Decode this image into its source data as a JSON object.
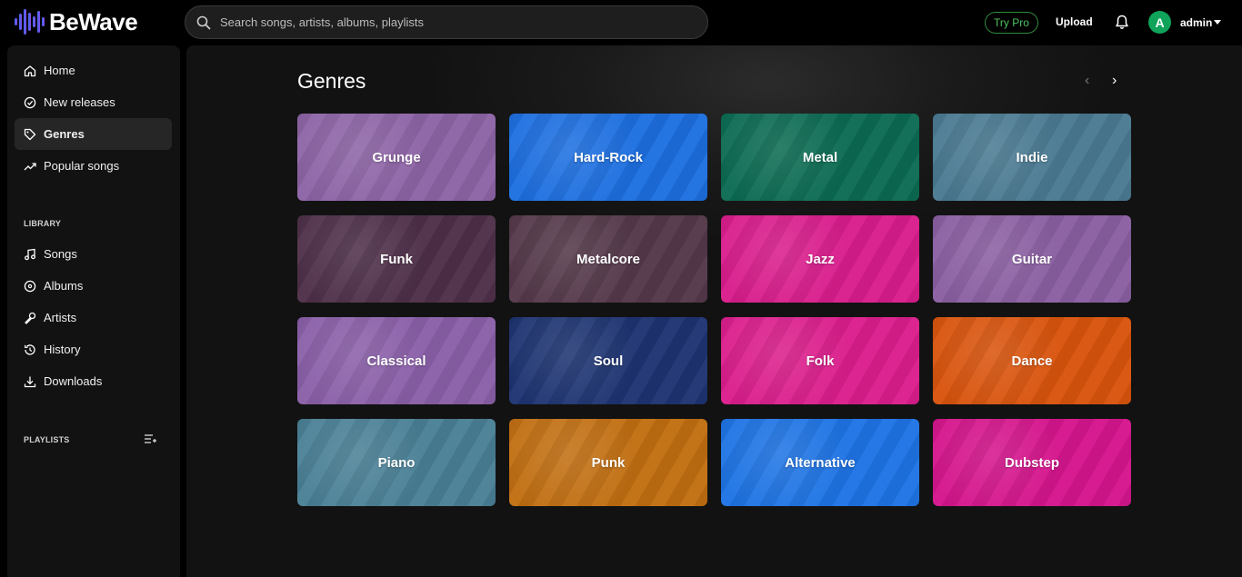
{
  "app": {
    "name": "BeWave"
  },
  "search": {
    "placeholder": "Search songs, artists, albums, playlists"
  },
  "header": {
    "try_pro": "Try Pro",
    "upload": "Upload",
    "avatar_initial": "A",
    "username": "admin"
  },
  "sidebar": {
    "main": [
      {
        "label": "Home",
        "icon": "home-icon"
      },
      {
        "label": "New releases",
        "icon": "check-circle-icon"
      },
      {
        "label": "Genres",
        "icon": "tag-icon",
        "active": true
      },
      {
        "label": "Popular songs",
        "icon": "trending-icon"
      }
    ],
    "library_label": "LIBRARY",
    "library": [
      {
        "label": "Songs",
        "icon": "music-note-icon"
      },
      {
        "label": "Albums",
        "icon": "album-icon"
      },
      {
        "label": "Artists",
        "icon": "microphone-icon"
      },
      {
        "label": "History",
        "icon": "history-icon"
      },
      {
        "label": "Downloads",
        "icon": "download-icon"
      }
    ],
    "playlists_label": "PLAYLISTS"
  },
  "main": {
    "title": "Genres",
    "genres": [
      {
        "name": "Grunge",
        "color": "#8d64a6"
      },
      {
        "name": "Hard-Rock",
        "color": "#1d6fe0"
      },
      {
        "name": "Metal",
        "color": "#0c6b53"
      },
      {
        "name": "Indie",
        "color": "#4a7a92"
      },
      {
        "name": "Funk",
        "color": "#4e3049"
      },
      {
        "name": "Metalcore",
        "color": "#543849"
      },
      {
        "name": "Jazz",
        "color": "#d91d8c"
      },
      {
        "name": "Guitar",
        "color": "#8a5fa1"
      },
      {
        "name": "Classical",
        "color": "#8a5fa8"
      },
      {
        "name": "Soul",
        "color": "#1e3472"
      },
      {
        "name": "Folk",
        "color": "#db1e8c"
      },
      {
        "name": "Dance",
        "color": "#d9540d"
      },
      {
        "name": "Piano",
        "color": "#4a8096"
      },
      {
        "name": "Punk",
        "color": "#c16f12"
      },
      {
        "name": "Alternative",
        "color": "#1e74e4"
      },
      {
        "name": "Dubstep",
        "color": "#d5158c"
      }
    ]
  }
}
